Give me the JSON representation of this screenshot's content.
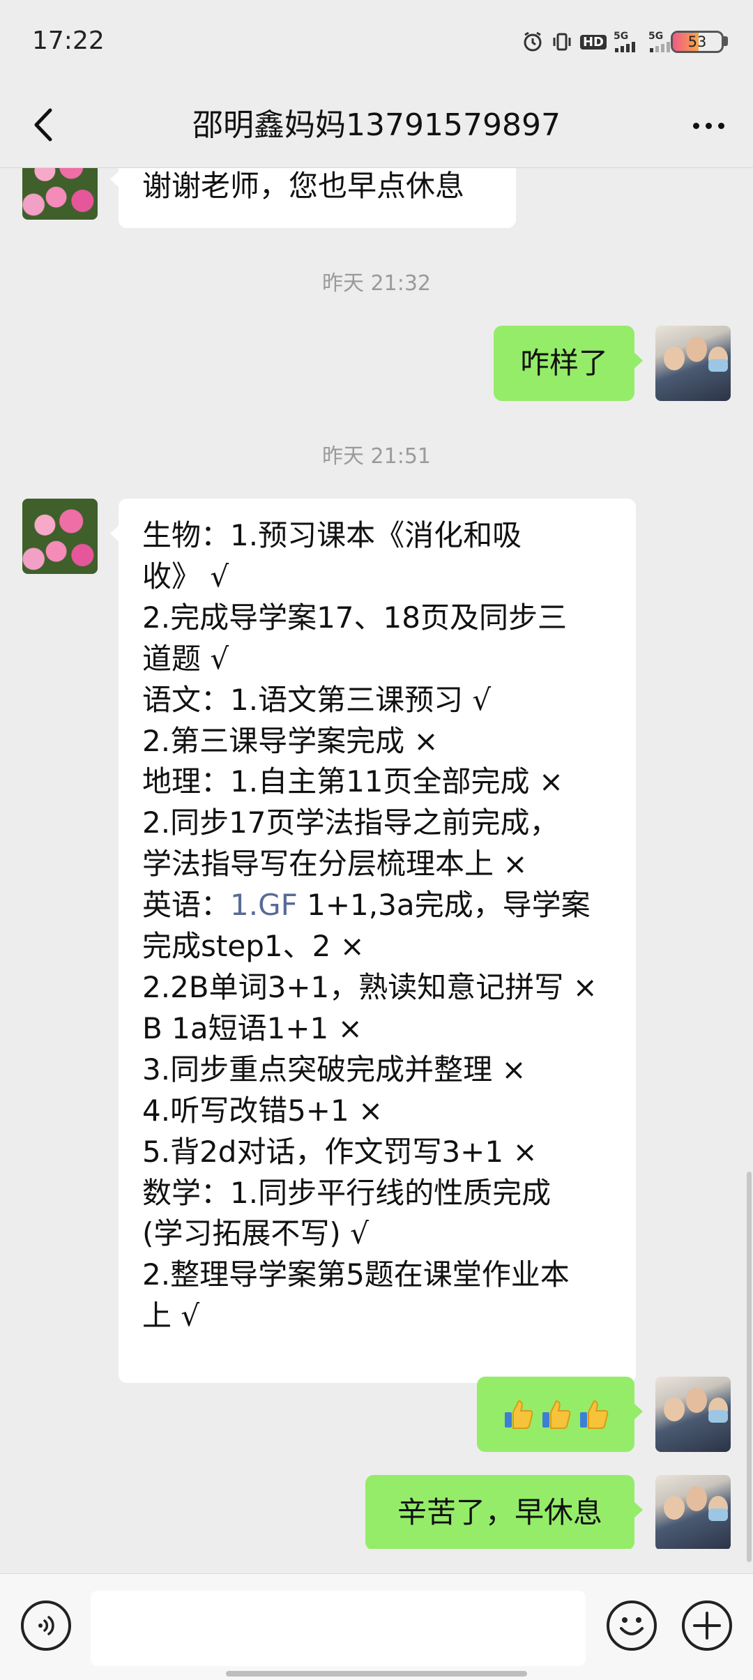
{
  "status_bar": {
    "time": "17:22",
    "icons": [
      "alarm-icon",
      "vibrate-icon",
      "hd-icon",
      "signal-5g-icon",
      "signal-5g-icon"
    ],
    "hd_label": "HD",
    "net1": "5G",
    "net2": "5G",
    "battery_level": "53"
  },
  "header": {
    "title": "邵明鑫妈妈13791579897"
  },
  "messages": {
    "m1_text": "谢谢老师，您也早点休息",
    "ts1": "昨天 21:32",
    "m2_text": "咋样了",
    "ts2": "昨天 21:51",
    "m3_lines": [
      "生物：1.预习课本《消化和吸",
      "收》 √",
      "2.完成导学案17、18页及同步三",
      "道题 √",
      "语文：1.语文第三课预习 √",
      "2.第三课导学案完成 ×",
      "地理：1.自主第11页全部完成 ×",
      "2.同步17页学法指导之前完成，",
      "学法指导写在分层梳理本上 ×",
      "英语：",
      "1.GF",
      " 1+1,3a完成，导学案",
      "完成step1、2 ×",
      "2.2B单词3+1，熟读知意记拼写 ×",
      "B 1a短语1+1 ×",
      "3.同步重点突破完成并整理 ×",
      "4.听写改错5+1 ×",
      "5.背2d对话，作文罚写3+1 ×",
      "数学：1.同步平行线的性质完成",
      "(学习拓展不写) √",
      "2.整理导学案第5题在课堂作业本",
      "上 √"
    ],
    "m4_icons": [
      "thumbs-up-icon",
      "thumbs-up-icon",
      "thumbs-up-icon"
    ],
    "m5_text": "辛苦了，早休息"
  },
  "colors": {
    "background": "#ededed",
    "sent_bubble": "#95ec69",
    "received_bubble": "#ffffff",
    "link": "#576b95",
    "timestamp": "#9a9a9a"
  }
}
